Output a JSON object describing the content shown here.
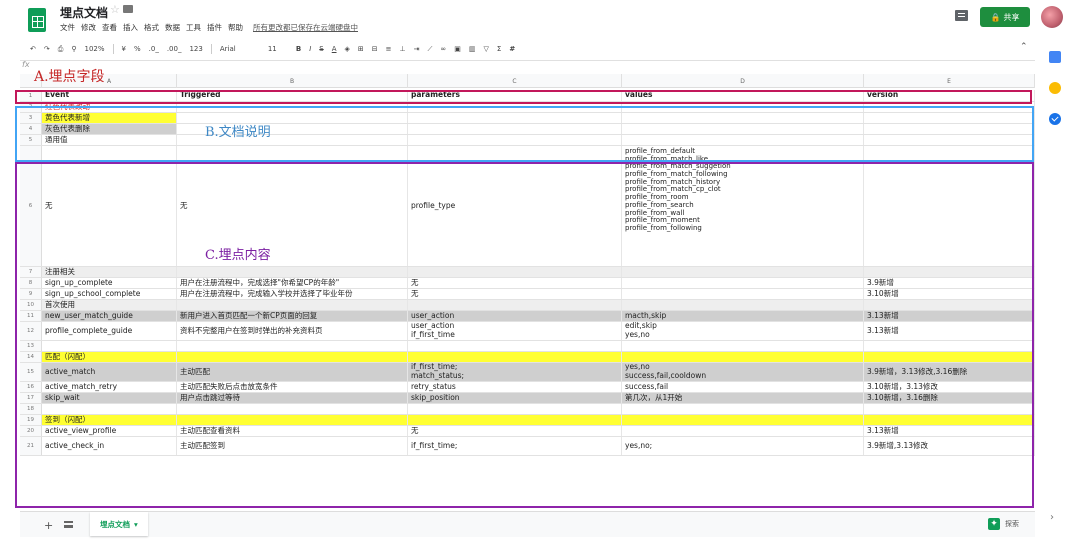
{
  "header": {
    "doc_title": "埋点文档",
    "menus": [
      "文件",
      "修改",
      "查看",
      "插入",
      "格式",
      "数据",
      "工具",
      "插件",
      "帮助"
    ],
    "saved_status": "所有更改都已保存在云端硬盘中",
    "share_label": "共享"
  },
  "toolbar": {
    "zoom": "102%",
    "currency": "¥",
    "percent": "%",
    "dec_less": ".0_",
    "dec_more": ".00_",
    "num_format": "123",
    "font": "Arial",
    "font_size": "11",
    "bold": "B",
    "italic": "I",
    "strike": "S",
    "text_color": "A",
    "func": "Σ",
    "fx": "fx"
  },
  "columns": [
    "A",
    "B",
    "C",
    "D",
    "E"
  ],
  "rows": [
    {
      "n": "1",
      "cells": [
        "Event",
        "Triggered",
        "parameters",
        "values",
        "version"
      ],
      "style": "bold"
    },
    {
      "n": "2",
      "cells": [
        "红色代表改动",
        "",
        "",
        "",
        ""
      ],
      "style": "",
      "a_color": "#d93025"
    },
    {
      "n": "3",
      "cells": [
        "黄色代表新增",
        "",
        "",
        "",
        ""
      ],
      "style": "",
      "a_bg": "yellow"
    },
    {
      "n": "4",
      "cells": [
        "灰色代表删除",
        "",
        "",
        "",
        ""
      ],
      "style": "",
      "a_bg": "gray"
    },
    {
      "n": "5",
      "cells": [
        "通用值",
        "",
        "",
        "",
        ""
      ],
      "style": ""
    },
    {
      "n": "6",
      "cells": [
        "无",
        "无",
        "profile_type",
        [
          "profile_from_default",
          "profile_from_match_like",
          "profile_from_match_suggetion",
          "profile_from_match_following",
          "profile_from_match_history",
          "profile_from_match_cp_clot",
          "profile_from_room",
          "profile_from_search",
          "profile_from_wall",
          "profile_from_moment",
          "profile_from_following"
        ],
        ""
      ],
      "style": ""
    },
    {
      "n": "7",
      "cells": [
        "注册相关",
        "",
        "",
        "",
        ""
      ],
      "style": "lgray"
    },
    {
      "n": "8",
      "cells": [
        "sign_up_complete",
        "用户在注册流程中，完成选择\"你希望CP的年龄\"",
        "无",
        "",
        "3.9新增"
      ],
      "style": ""
    },
    {
      "n": "9",
      "cells": [
        "sign_up_school_complete",
        "用户在注册流程中，完成输入学校并选择了毕业年份",
        "无",
        "",
        "3.10新增"
      ],
      "style": ""
    },
    {
      "n": "10",
      "cells": [
        "首次使用",
        "",
        "",
        "",
        ""
      ],
      "style": "lgray"
    },
    {
      "n": "11",
      "cells": [
        "new_user_match_guide",
        "新用户进入首页匹配一个新CP页面的回复",
        "user_action",
        "macth,skip",
        "3.13新增"
      ],
      "style": "gray"
    },
    {
      "n": "12",
      "cells": [
        "profile_complete_guide",
        "资料不完整用户在签到时弹出的补充资料页",
        [
          "user_action",
          " if_first_time"
        ],
        [
          "edit,skip",
          " yes,no"
        ],
        "3.13新增"
      ],
      "style": ""
    },
    {
      "n": "13",
      "cells": [
        "",
        "",
        "",
        "",
        ""
      ],
      "style": ""
    },
    {
      "n": "14",
      "cells": [
        "匹配（闪配）",
        "",
        "",
        "",
        ""
      ],
      "style": "yellow"
    },
    {
      "n": "15",
      "cells": [
        "active_match",
        "主动匹配",
        [
          "if_first_time;",
          " match_status;"
        ],
        [
          "yes,no",
          " success,fail,cooldown"
        ],
        "3.9新增，3.13修改,3.16删除"
      ],
      "style": "gray"
    },
    {
      "n": "16",
      "cells": [
        "active_match_retry",
        "主动匹配失败后点击放宽条件",
        "retry_status",
        "success,fail",
        "3.10新增，3.13修改"
      ],
      "style": ""
    },
    {
      "n": "17",
      "cells": [
        "skip_wait",
        "用户点击跳过等待",
        "skip_position",
        "第几次，从1开始",
        "3.10新增，3.16删除"
      ],
      "style": "gray"
    },
    {
      "n": "18",
      "cells": [
        "",
        "",
        "",
        "",
        ""
      ],
      "style": ""
    },
    {
      "n": "19",
      "cells": [
        "签到（闪配）",
        "",
        "",
        "",
        ""
      ],
      "style": "yellow"
    },
    {
      "n": "20",
      "cells": [
        "active_view_profile",
        "主动匹配查看资料",
        "无",
        "",
        "3.13新增"
      ],
      "style": ""
    },
    {
      "n": "21",
      "cells": [
        "active_check_in",
        "主动匹配签到",
        "if_first_time;",
        "yes,no;",
        "3.9新增,3.13修改"
      ],
      "style": ""
    }
  ],
  "annotations": {
    "a": "A.埋点字段",
    "b": "B.文档说明",
    "c": "C.埋点内容"
  },
  "bottom": {
    "add": "+",
    "sheet_name": "埋点文档",
    "explore_label": "探索"
  }
}
